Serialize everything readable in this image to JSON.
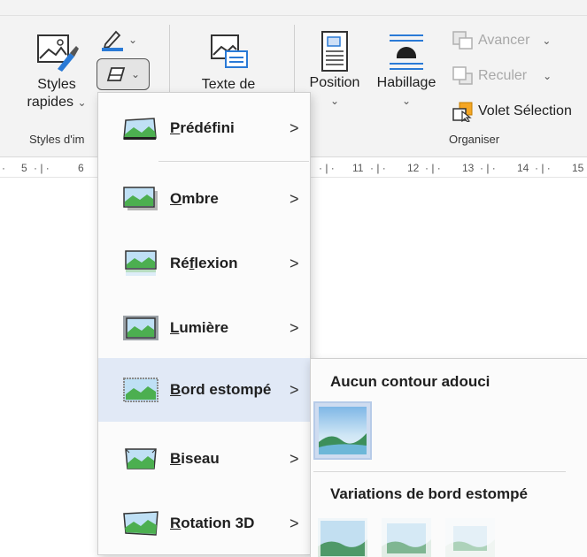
{
  "ribbon": {
    "styles_rapides": {
      "line1": "Styles",
      "line2": "rapides"
    },
    "texte_de": "Texte de",
    "position": "Position",
    "habillage": "Habillage",
    "avancer": "Avancer",
    "reculer": "Reculer",
    "volet_selection": "Volet Sélection",
    "group_styles": "Styles d'im",
    "group_organiser": "Organiser",
    "chevron": "⌄"
  },
  "ruler": {
    "left": [
      "5",
      "6"
    ],
    "right": [
      "11",
      "12",
      "13",
      "14",
      "15"
    ]
  },
  "menu": {
    "items": [
      {
        "label_ul": "P",
        "label_rest": "rédéfini"
      },
      {
        "label_ul": "O",
        "label_rest": "mbre"
      },
      {
        "label_pre": "Ré",
        "label_ul": "f",
        "label_rest": "lexion"
      },
      {
        "label_ul": "L",
        "label_rest": "umière"
      },
      {
        "label_ul": "B",
        "label_rest": "ord estompé"
      },
      {
        "label_ul": "B",
        "label_rest": "iseau"
      },
      {
        "label_ul": "R",
        "label_rest": "otation 3D"
      }
    ],
    "arrow": ">"
  },
  "submenu": {
    "heading1": "Aucun contour adouci",
    "heading2": "Variations de bord estompé"
  },
  "colors": {
    "accent_blue": "#185abd",
    "active_bg": "#e1e9f6",
    "icon_green": "#4caf50"
  }
}
